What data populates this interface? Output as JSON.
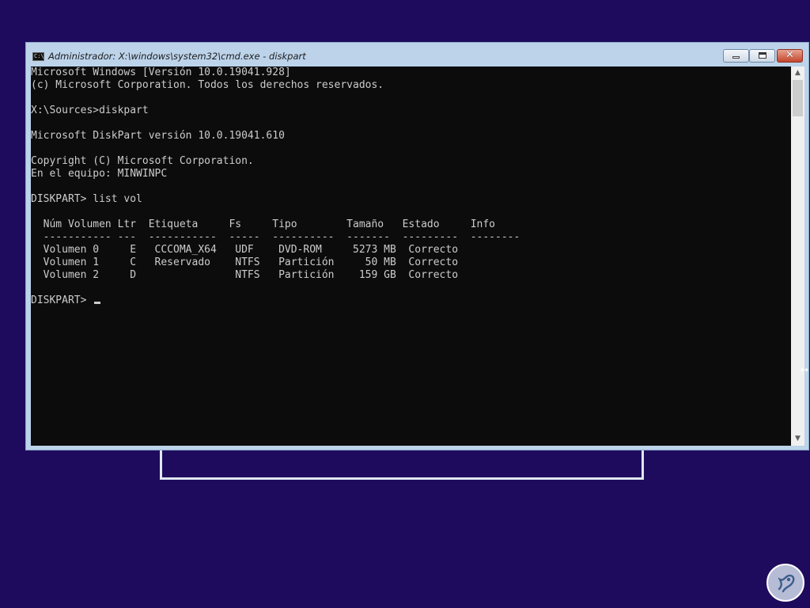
{
  "window": {
    "title": "Administrador: X:\\windows\\system32\\cmd.exe - diskpart",
    "app_icon_text": "C:\\",
    "close_glyph": "✕"
  },
  "console": {
    "lines": [
      "Microsoft Windows [Versión 10.0.19041.928]",
      "(c) Microsoft Corporation. Todos los derechos reservados.",
      "",
      "X:\\Sources>diskpart",
      "",
      "Microsoft DiskPart versión 10.0.19041.610",
      "",
      "Copyright (C) Microsoft Corporation.",
      "En el equipo: MINWINPC",
      "",
      "DISKPART> list vol",
      "",
      "  Núm Volumen Ltr  Etiqueta     Fs     Tipo        Tamaño   Estado     Info",
      "  ----------- ---  -----------  -----  ----------  -------  ---------  --------",
      "  Volumen 0     E   CCCOMA_X64   UDF    DVD-ROM     5273 MB  Correcto",
      "  Volumen 1     C   Reservado    NTFS   Partición     50 MB  Correcto",
      "  Volumen 2     D                NTFS   Partición    159 GB  Correcto",
      ""
    ],
    "prompt": "DISKPART> "
  },
  "scrollbar": {
    "up_glyph": "▲",
    "down_glyph": "▼"
  },
  "colors": {
    "desktop_background": "#1f0b5d",
    "console_background": "#0c0c0c",
    "console_text": "#cccccc",
    "window_frame": "#bcd3ea",
    "close_button": "#c5462d"
  },
  "icons": {
    "app": "cmd-icon",
    "minimize": "minimize-icon",
    "maximize": "maximize-icon",
    "close": "close-icon",
    "resize_cursor": "resize-cursor-icon",
    "logo": "logo-icon"
  }
}
